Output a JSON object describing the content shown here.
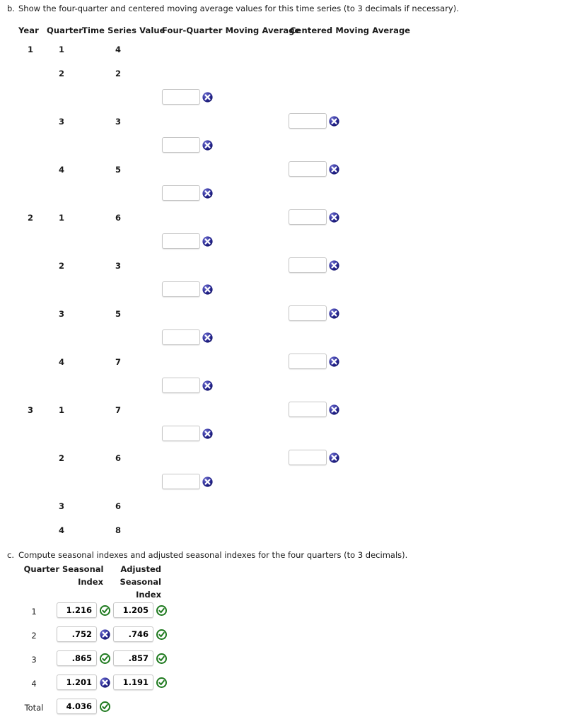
{
  "part_b": {
    "prompt_marker": "b.",
    "prompt_text": "Show the four-quarter and centered moving average values for this time series (to 3 decimals if necessary).",
    "headers": {
      "year": "Year",
      "quarter": "Quarter",
      "value": "Time Series Value",
      "four_quarter": "Four-Quarter Moving Average",
      "centered": "Centered Moving Average"
    },
    "rows": [
      {
        "kind": "data",
        "year": "1",
        "quarter": "1",
        "value": "4",
        "centered": null
      },
      {
        "kind": "data",
        "year": "",
        "quarter": "2",
        "value": "2",
        "centered": null
      },
      {
        "kind": "ma",
        "four_quarter": {
          "value": "",
          "status": "incorrect"
        }
      },
      {
        "kind": "data",
        "year": "",
        "quarter": "3",
        "value": "3",
        "centered": {
          "value": "",
          "status": "incorrect"
        }
      },
      {
        "kind": "ma",
        "four_quarter": {
          "value": "",
          "status": "incorrect"
        }
      },
      {
        "kind": "data",
        "year": "",
        "quarter": "4",
        "value": "5",
        "centered": {
          "value": "",
          "status": "incorrect"
        }
      },
      {
        "kind": "ma",
        "four_quarter": {
          "value": "",
          "status": "incorrect"
        }
      },
      {
        "kind": "data",
        "year": "2",
        "quarter": "1",
        "value": "6",
        "centered": {
          "value": "",
          "status": "incorrect"
        }
      },
      {
        "kind": "ma",
        "four_quarter": {
          "value": "",
          "status": "incorrect"
        }
      },
      {
        "kind": "data",
        "year": "",
        "quarter": "2",
        "value": "3",
        "centered": {
          "value": "",
          "status": "incorrect"
        }
      },
      {
        "kind": "ma",
        "four_quarter": {
          "value": "",
          "status": "incorrect"
        }
      },
      {
        "kind": "data",
        "year": "",
        "quarter": "3",
        "value": "5",
        "centered": {
          "value": "",
          "status": "incorrect"
        }
      },
      {
        "kind": "ma",
        "four_quarter": {
          "value": "",
          "status": "incorrect"
        }
      },
      {
        "kind": "data",
        "year": "",
        "quarter": "4",
        "value": "7",
        "centered": {
          "value": "",
          "status": "incorrect"
        }
      },
      {
        "kind": "ma",
        "four_quarter": {
          "value": "",
          "status": "incorrect"
        }
      },
      {
        "kind": "data",
        "year": "3",
        "quarter": "1",
        "value": "7",
        "centered": {
          "value": "",
          "status": "incorrect"
        }
      },
      {
        "kind": "ma",
        "four_quarter": {
          "value": "",
          "status": "incorrect"
        }
      },
      {
        "kind": "data",
        "year": "",
        "quarter": "2",
        "value": "6",
        "centered": {
          "value": "",
          "status": "incorrect"
        }
      },
      {
        "kind": "ma",
        "four_quarter": {
          "value": "",
          "status": "incorrect"
        }
      },
      {
        "kind": "data",
        "year": "",
        "quarter": "3",
        "value": "6",
        "centered": null
      },
      {
        "kind": "data",
        "year": "",
        "quarter": "4",
        "value": "8",
        "centered": null
      }
    ]
  },
  "part_c": {
    "prompt_marker": "c.",
    "prompt_text": "Compute seasonal indexes and adjusted seasonal indexes for the four quarters (to 3 decimals).",
    "headers": {
      "quarter": "Quarter",
      "seasonal_index": "Seasonal\nIndex",
      "seasonal_index_line1": "Seasonal",
      "seasonal_index_line2": "Index",
      "adjusted_line1": "Adjusted",
      "adjusted_line2": "Seasonal",
      "adjusted_line3": "Index"
    },
    "rows": [
      {
        "quarter": "1",
        "seasonal": {
          "value": "1.216",
          "status": "correct"
        },
        "adjusted": {
          "value": "1.205",
          "status": "correct"
        }
      },
      {
        "quarter": "2",
        "seasonal": {
          "value": ".752",
          "status": "incorrect"
        },
        "adjusted": {
          "value": ".746",
          "status": "correct"
        }
      },
      {
        "quarter": "3",
        "seasonal": {
          "value": ".865",
          "status": "correct"
        },
        "adjusted": {
          "value": ".857",
          "status": "correct"
        }
      },
      {
        "quarter": "4",
        "seasonal": {
          "value": "1.201",
          "status": "incorrect"
        },
        "adjusted": {
          "value": "1.191",
          "status": "correct"
        }
      }
    ],
    "total_row": {
      "label": "Total",
      "seasonal": {
        "value": "4.036",
        "status": "correct"
      }
    }
  },
  "icons": {
    "incorrect": "x-circle-icon",
    "correct": "check-circle-icon"
  },
  "colors": {
    "incorrect_blue": "#2b2b96",
    "incorrect_blue_light": "#6f6fd0",
    "correct_green": "#1f7a1f",
    "correct_green_light": "#3ea93e",
    "text": "#1a1a1a",
    "box_border": "#c6c6c6",
    "page_background": "#ffffff"
  }
}
